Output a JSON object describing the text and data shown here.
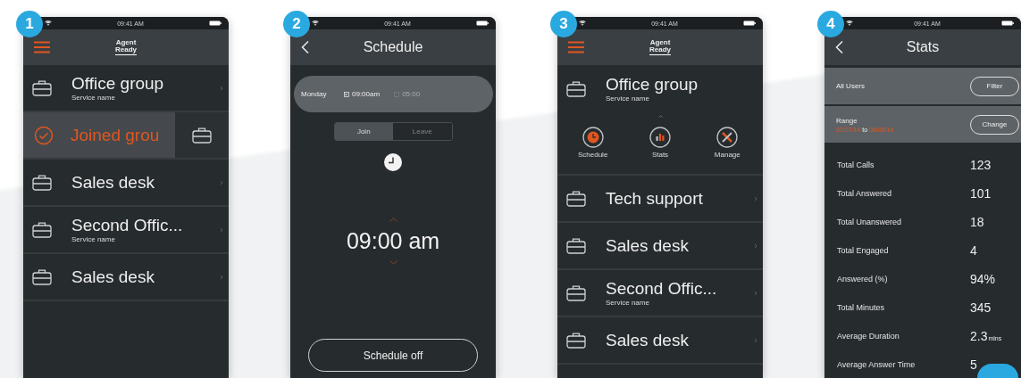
{
  "screens": [
    {
      "kind": "groups",
      "badge": "1",
      "time": "09:41 AM",
      "logo": {
        "line_1": "Agent",
        "line_2": "Ready"
      },
      "rows": [
        {
          "kind": "group",
          "title": "Office group",
          "subtitle": "Service name"
        },
        {
          "kind": "swiped",
          "title": "Joined grou"
        },
        {
          "kind": "group",
          "title": "Sales desk"
        },
        {
          "kind": "group",
          "title": "Second Offic...",
          "subtitle": "Service name"
        },
        {
          "kind": "group",
          "title": "Sales desk"
        }
      ]
    },
    {
      "kind": "schedule",
      "badge": "2",
      "time": "09:41 AM",
      "title": "Schedule",
      "day": {
        "name": "Monday",
        "join_time": "09:00am",
        "leave_time": "05:00"
      },
      "segments": [
        {
          "label": "Join",
          "selected": true
        },
        {
          "label": "Leave",
          "selected": false
        }
      ],
      "time_value": "09:00 am",
      "button": "Schedule off"
    },
    {
      "kind": "groups",
      "badge": "3",
      "time": "09:41 AM",
      "logo": {
        "line_1": "Agent",
        "line_2": "Ready"
      },
      "rows": [
        {
          "kind": "expanded",
          "title": "Office group",
          "subtitle": "Service name",
          "actions": [
            {
              "kind": "schedule",
              "label": "Schedule"
            },
            {
              "kind": "stats",
              "label": "Stats"
            },
            {
              "kind": "manage",
              "label": "Manage"
            }
          ]
        },
        {
          "kind": "group",
          "title": "Tech support"
        },
        {
          "kind": "group",
          "title": "Sales desk"
        },
        {
          "kind": "group",
          "title": "Second Offic...",
          "subtitle": "Service name"
        },
        {
          "kind": "group",
          "title": "Sales desk"
        }
      ]
    },
    {
      "kind": "stats",
      "badge": "4",
      "time": "09:41 AM",
      "title": "Stats",
      "filter": {
        "label": "All Users",
        "button": "Filter"
      },
      "range": {
        "label": "Range",
        "from": "31/07/14",
        "separator": "to",
        "to": "06/08/14",
        "button": "Change"
      },
      "stats": [
        {
          "label": "Total Calls",
          "value": "123"
        },
        {
          "label": "Total Answered",
          "value": "101"
        },
        {
          "label": "Total Unanswered",
          "value": "18"
        },
        {
          "label": "Total Engaged",
          "value": "4"
        },
        {
          "label": "Answered (%)",
          "value": "94%"
        },
        {
          "label": "Total Minutes",
          "value": "345"
        },
        {
          "label": "Average Duration",
          "value": "2.3",
          "unit": "mins"
        },
        {
          "label": "Average Answer  Time",
          "value": "5"
        }
      ]
    }
  ]
}
